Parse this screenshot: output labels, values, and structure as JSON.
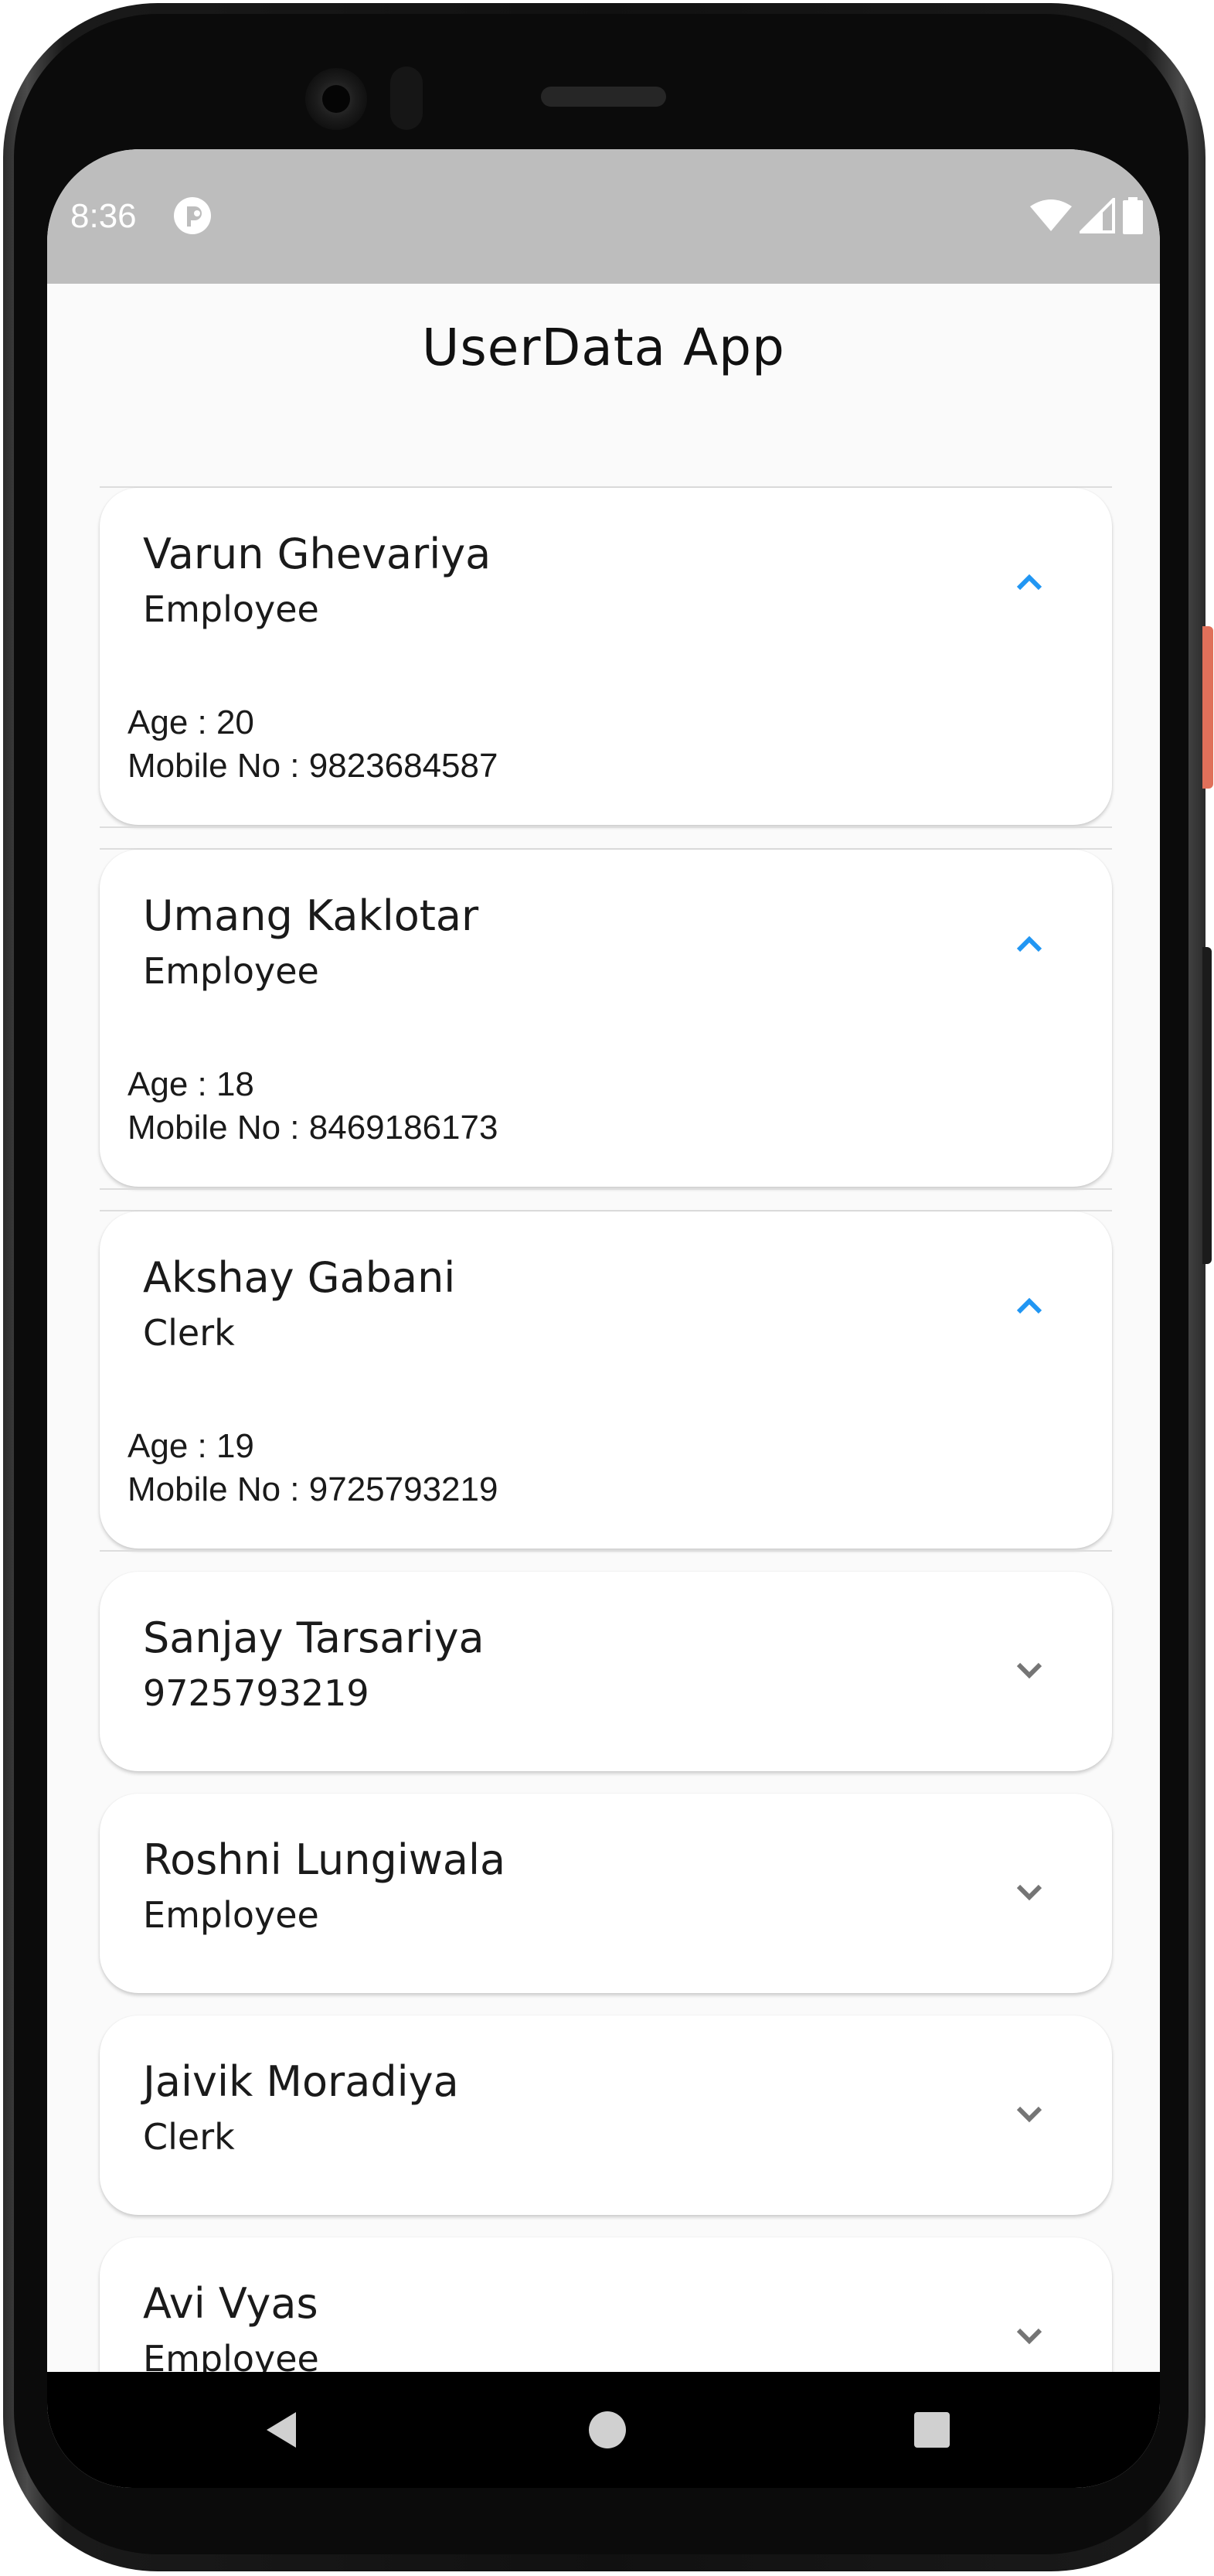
{
  "status_bar": {
    "time": "8:36",
    "notification_icon": "app-notification-icon",
    "icons": [
      "wifi-icon",
      "cellular-signal-icon",
      "battery-icon"
    ],
    "background": "#bdbdbd"
  },
  "app": {
    "title": "UserData App"
  },
  "users": [
    {
      "name": "Varun Ghevariya",
      "subtitle": "Employee",
      "expanded": true,
      "age": "Age : 20",
      "mobile": "Mobile No : 9823684587"
    },
    {
      "name": "Umang Kaklotar",
      "subtitle": "Employee",
      "expanded": true,
      "age": "Age : 18",
      "mobile": "Mobile No : 8469186173"
    },
    {
      "name": "Akshay Gabani",
      "subtitle": "Clerk",
      "expanded": true,
      "age": "Age : 19",
      "mobile": "Mobile No : 9725793219"
    },
    {
      "name": "Sanjay Tarsariya",
      "subtitle": "9725793219",
      "expanded": false
    },
    {
      "name": "Roshni Lungiwala",
      "subtitle": "Employee",
      "expanded": false
    },
    {
      "name": "Jaivik Moradiya",
      "subtitle": "Clerk",
      "expanded": false
    },
    {
      "name": "Avi Vyas",
      "subtitle": "Employee",
      "expanded": false
    }
  ],
  "nav_bar": {
    "icons": [
      "back-icon",
      "home-icon",
      "recents-icon"
    ]
  },
  "colors": {
    "accent_expanded_chevron": "#2196f3",
    "collapsed_chevron": "#757575",
    "screen_background": "#fafafa",
    "card_background": "#ffffff"
  }
}
